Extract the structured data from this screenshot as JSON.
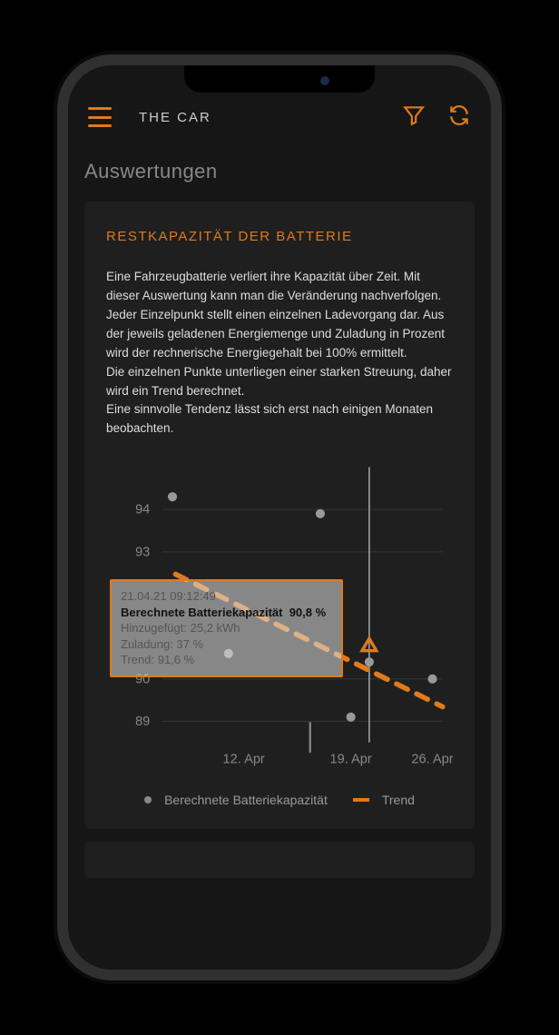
{
  "header": {
    "title": "THE CAR"
  },
  "page_title": "Auswertungen",
  "card": {
    "title": "RESTKAPAZITÄT DER BATTERIE",
    "description": "Eine Fahrzeugbatterie verliert ihre Kapazität über Zeit. Mit dieser Auswertung kann man die Veränderung nachverfolgen.\nJeder Einzelpunkt stellt einen einzelnen Ladevorgang dar. Aus der jeweils geladenen Energiemenge und Zuladung in Prozent wird der rechnerische Energiegehalt bei 100% ermittelt.\nDie einzelnen Punkte unterliegen einer starken Streuung, daher wird ein Trend berechnet.\nEine sinnvolle Tendenz lässt sich erst nach einigen Monaten beobachten."
  },
  "tooltip": {
    "timestamp": "21.04.21 09:12:49",
    "main_label": "Berechnete Batteriekapazität",
    "main_value": "90,8 %",
    "added_label": "Hinzugefügt:",
    "added_value": "25,2 kWh",
    "load_label": "Zuladung:",
    "load_value": "37 %",
    "trend_label": "Trend:",
    "trend_value": "91,6 %"
  },
  "legend": {
    "series1": "Berechnete Batteriekapazität",
    "series2": "Trend"
  },
  "chart_data": {
    "type": "scatter",
    "title": "Restkapazität der Batterie",
    "xlabel": "",
    "ylabel": "",
    "x_ticks": [
      "12. Apr",
      "19. Apr",
      "26. Apr"
    ],
    "y_ticks": [
      89,
      90,
      93,
      94
    ],
    "ylim": [
      88.5,
      95
    ],
    "series": [
      {
        "name": "Berechnete Batteriekapazität",
        "type": "scatter",
        "points": [
          {
            "x": "07. Apr",
            "y": 94.3
          },
          {
            "x": "11. Apr",
            "y": 90.6
          },
          {
            "x": "17. Apr",
            "y": 93.9
          },
          {
            "x": "19. Apr",
            "y": 89.1
          },
          {
            "x": "21. Apr",
            "y": 90.4
          },
          {
            "x": "26. Apr",
            "y": 90.0
          }
        ]
      },
      {
        "name": "Trend",
        "type": "line",
        "points": [
          {
            "x": "07. Apr",
            "y": 92.5
          },
          {
            "x": "26. Apr",
            "y": 89.6
          }
        ]
      }
    ],
    "highlighted_point": {
      "x": "21. Apr",
      "y": 90.8,
      "trend_y": 91.6
    }
  }
}
